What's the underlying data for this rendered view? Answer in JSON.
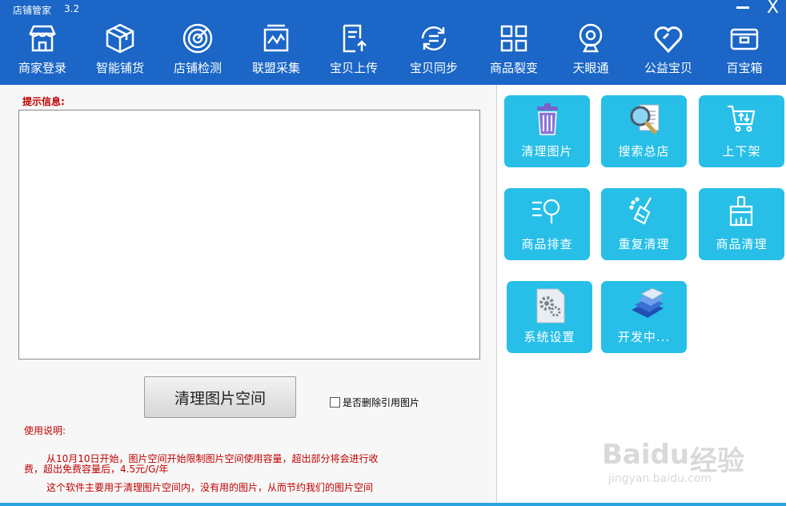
{
  "app": {
    "title": "店铺管家",
    "version": "3.2",
    "close_label": "X"
  },
  "nav": [
    {
      "label": "商家登录",
      "icon": "storefront-icon"
    },
    {
      "label": "智能铺货",
      "icon": "box-icon"
    },
    {
      "label": "店铺检测",
      "icon": "radar-icon"
    },
    {
      "label": "联盟采集",
      "icon": "chart-monitor-icon"
    },
    {
      "label": "宝贝上传",
      "icon": "upload-document-icon"
    },
    {
      "label": "宝贝同步",
      "icon": "sync-icon"
    },
    {
      "label": "商品裂变",
      "icon": "grid-icon"
    },
    {
      "label": "天眼通",
      "icon": "webcam-icon"
    },
    {
      "label": "公益宝贝",
      "icon": "heart-icon"
    },
    {
      "label": "百宝箱",
      "icon": "wallet-icon"
    }
  ],
  "main": {
    "hint_label": "提示信息:",
    "log_text": "",
    "clean_button": "清理图片空间",
    "checkbox_label": "是否删除引用图片",
    "checkbox_checked": false,
    "usage_title": "使用说明:",
    "usage_line1a": "从10月10日开始，图片空间开始限制图片空间使用容量，超出部分将会进行收",
    "usage_line1b": "费，超出免费容量后，4.5元/G/年",
    "usage_line2": "这个软件主要用于清理图片空间内，没有用的图片，从而节约我们的图片空间"
  },
  "tiles": [
    {
      "label": "清理图片",
      "icon": "trash-can-icon"
    },
    {
      "label": "搜索总店",
      "icon": "magnifier-document-icon"
    },
    {
      "label": "上下架",
      "icon": "shopping-cart-icon"
    },
    {
      "label": "商品排查",
      "icon": "search-list-icon"
    },
    {
      "label": "重复清理",
      "icon": "broom-icon"
    },
    {
      "label": "商品清理",
      "icon": "brush-icon"
    },
    {
      "label": "系统设置",
      "icon": "gear-document-icon"
    },
    {
      "label": "开发中...",
      "icon": "document-stack-icon"
    }
  ],
  "watermark": {
    "brand": "Baidu",
    "cn": "经验",
    "url": "jingyan.baidu.com"
  },
  "colors": {
    "topbar": "#1b66c6",
    "tile": "#27bfe7",
    "hint_red": "#c00000"
  }
}
